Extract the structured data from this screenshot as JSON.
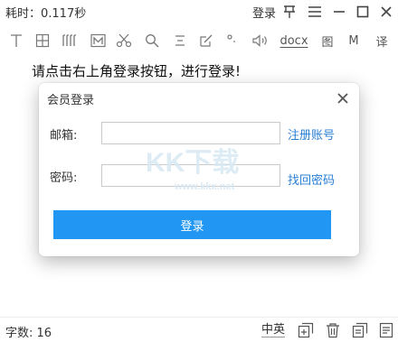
{
  "titlebar": {
    "elapsed_label": "耗时：0.117秒",
    "login_label": "登录",
    "icons": [
      "pin-icon",
      "menu-icon",
      "minimize-icon",
      "maximize-icon",
      "close-icon"
    ]
  },
  "toolbar": {
    "docx_label": "docx",
    "image_label": "图",
    "m_label": "M",
    "translate_label": "译"
  },
  "main": {
    "prompt": "请点击右上角登录按钮，进行登录!"
  },
  "modal": {
    "title": "会员登录",
    "email_label": "邮箱:",
    "email_value": "",
    "register_link": "注册账号",
    "password_label": "密码:",
    "password_value": "",
    "recover_link": "找回密码",
    "login_button": "登录",
    "watermark_text": "KK下载",
    "watermark_url": "www.kkx.net"
  },
  "statusbar": {
    "word_count": "字数: 16",
    "lang_toggle": "中英"
  },
  "colors": {
    "accent": "#2196f3",
    "link": "#2a7fd4"
  }
}
